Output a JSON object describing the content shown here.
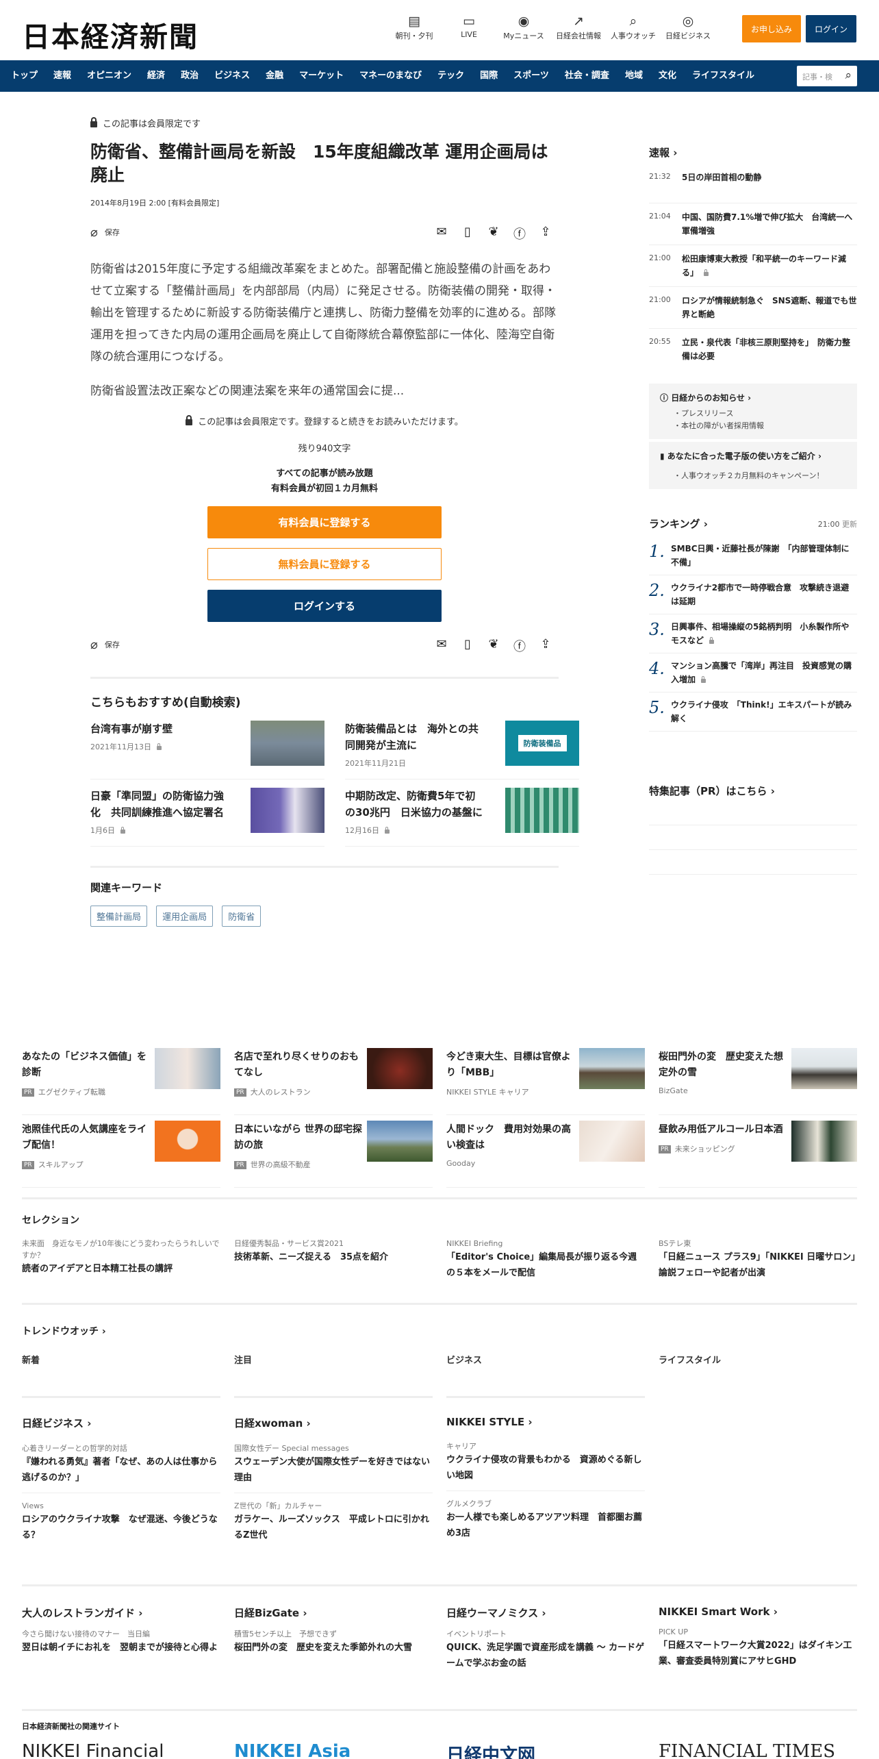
{
  "header": {
    "logo": "日本経済新聞",
    "icons": [
      {
        "label": "朝刊・夕刊",
        "icon": "newspaper-icon",
        "glyph": "▤"
      },
      {
        "label": "LIVE",
        "icon": "video-icon",
        "glyph": "▭"
      },
      {
        "label": "Myニュース",
        "icon": "user-icon",
        "glyph": "◉"
      },
      {
        "label": "日経会社情報",
        "icon": "chart-icon",
        "glyph": "↗"
      },
      {
        "label": "人事ウオッチ",
        "icon": "search-person-icon",
        "glyph": "⌕"
      },
      {
        "label": "日経ビジネス",
        "icon": "compass-icon",
        "glyph": "◎"
      }
    ],
    "apply_label": "お申し込み",
    "login_label": "ログイン"
  },
  "nav": {
    "items": [
      "トップ",
      "速報",
      "オピニオン",
      "経済",
      "政治",
      "ビジネス",
      "金融",
      "マーケット",
      "マネーのまなび",
      "テック",
      "国際",
      "スポーツ",
      "社会・調査",
      "地域",
      "文化",
      "ライフスタイル"
    ],
    "search_placeholder": "記事・検"
  },
  "article": {
    "member_only": "この記事は会員限定です",
    "title": "防衛省、整備計画局を新設　15年度組織改革 運用企画局は廃止",
    "date": "2014年8月19日 2:00 [有料会員限定]",
    "save_label": "保存",
    "body": [
      "防衛省は2015年度に予定する組織改革案をまとめた。部署配備と施設整備の計画をあわせて立案する「整備計画局」を内部部局（内局）に発足させる。防衛装備の開発・取得・輸出を管理するために新設する防衛装備庁と連携し、防衛力整備を効率的に進める。部隊運用を担ってきた内局の運用企画局を廃止して自衛隊統合幕僚監部に一体化、陸海空自衛隊の統合運用につなげる。",
      "防衛省設置法改正案などの関連法案を来年の通常国会に提..."
    ],
    "paywall_note": "この記事は会員限定です。登録すると続きをお読みいただけます。",
    "remaining": "残り940文字",
    "perk1": "すべての記事が読み放題",
    "perk2": "有料会員が初回１カ月無料",
    "btn_paid": "有料会員に登録する",
    "btn_free": "無料会員に登録する",
    "btn_login": "ログインする"
  },
  "recommend": {
    "heading": "こちらもおすすめ(自動検索)",
    "items": [
      {
        "title": "台湾有事が崩す壁",
        "date": "2021年11月13日"
      },
      {
        "title": "防衛装備品とは　海外との共同開発が主流に",
        "date": "2021年11月21日",
        "thumb_text": "防衛装備品"
      },
      {
        "title": "日豪「準同盟」の防衛協力強化　共同訓練推進へ協定署名",
        "date": "1月6日"
      },
      {
        "title": "中期防改定、防衛費5年で初の30兆円　日米協力の基盤に",
        "date": "12月16日"
      }
    ]
  },
  "keywords": {
    "heading": "関連キーワード",
    "items": [
      "整備計画局",
      "運用企画局",
      "防衛省"
    ]
  },
  "sidebar": {
    "flash_heading": "速報",
    "flash": [
      {
        "time": "21:32",
        "text": "5日の岸田首相の動静"
      },
      {
        "time": "21:04",
        "text": "中国、国防費7.1%増で伸び拡大　台湾統一へ軍備増強"
      },
      {
        "time": "21:00",
        "text": "松田康博東大教授「和平統一のキーワード減る」"
      },
      {
        "time": "21:00",
        "text": "ロシアが情報統制急ぐ　SNS遮断、報道でも世界と断絶"
      },
      {
        "time": "20:55",
        "text": "立民・泉代表「非核三原則堅持を」　防衛力整備は必要"
      }
    ],
    "notice_heading": "日経からのお知らせ",
    "notices": [
      "プレスリリース",
      "本社の障がい者採用情報"
    ],
    "ebook_heading": "あなたに合った電子版の使い方をご紹介",
    "ebook_items": [
      "人事ウオッチ２カ月無料のキャンペーン！"
    ],
    "ranking_heading": "ランキング",
    "ranking_time": "21:00",
    "ranking_update": "更新",
    "ranking": [
      {
        "n": "1.",
        "text": "SMBC日興・近藤社長が陳謝　「内部管理体制に不備」"
      },
      {
        "n": "2.",
        "text": "ウクライナ2都市で一時停戦合意　攻撃続き退避は延期"
      },
      {
        "n": "3.",
        "text": "日興事件、相場操縦の5銘柄判明　小糸製作所やモスなど"
      },
      {
        "n": "4.",
        "text": "マンション高騰で「湾岸」再注目　投資感覚の購入増加"
      },
      {
        "n": "5.",
        "text": "ウクライナ侵攻　「Think!」エキスパートが読み解く"
      }
    ],
    "pr_heading": "特集記事（PR）はこちら"
  },
  "ads": [
    {
      "title": "あなたの「ビジネス価値」を診断",
      "src": "エグゼクティブ転職",
      "pr": true
    },
    {
      "title": "名店で至れり尽くせりのおもてなし",
      "src": "大人のレストラン",
      "pr": true
    },
    {
      "title": "今どき東大生、目標は官僚より「MBB」",
      "src": "NIKKEI STYLE キャリア",
      "pr": false
    },
    {
      "title": "桜田門外の変　歴史変えた想定外の雪",
      "src": "BizGate",
      "pr": false
    },
    {
      "title": "池照佳代氏の人気講座をライブ配信！",
      "src": "スキルアップ",
      "pr": true
    },
    {
      "title": "日本にいながら 世界の邸宅探訪の旅",
      "src": "世界の高級不動産",
      "pr": true
    },
    {
      "title": "人間ドック　費用対効果の高い検査は",
      "src": "Gooday",
      "pr": false
    },
    {
      "title": "昼飲み用低アルコール日本酒",
      "src": "未来ショッピング",
      "pr": true
    }
  ],
  "pr_label": "PR",
  "selection": {
    "heading": "セレクション",
    "items": [
      {
        "small": "未来面　身近なモノが10年後にどう変わったらうれしいですか？",
        "title": "読者のアイデアと日本精工社長の講評"
      },
      {
        "small": "日経優秀製品・サービス賞2021",
        "title": "技術革新、ニーズ捉える　35点を紹介"
      },
      {
        "small": "NIKKEI Briefing",
        "title": "「Editor's Choice」編集局長が振り返る今週の５本をメールで配信"
      },
      {
        "small": "BSテレ東",
        "title": "「日経ニュース プラス9」「NIKKEI 日曜サロン」論説フェローや記者が出演"
      }
    ]
  },
  "trend": {
    "heading": "トレンドウオッチ",
    "tabs": [
      "新着",
      "注目",
      "ビジネス",
      "ライフスタイル"
    ],
    "columns": [
      {
        "brand": "日経ビジネス",
        "entries": [
          {
            "small": "心着きリーダーとの哲学的対話",
            "title": "『嫌われる勇気』著者「なぜ、あの人は仕事から逃げるのか？」"
          },
          {
            "small": "Views",
            "title": "ロシアのウクライナ攻撃　なぜ混迷、今後どうなる？"
          }
        ]
      },
      {
        "brand": "日経xwoman",
        "entries": [
          {
            "small": "国際女性デー Special messages",
            "title": "スウェーデン大使が国際女性デーを好きではない理由"
          },
          {
            "small": "Z世代の「新」カルチャー",
            "title": "ガラケー、ルーズソックス　平成レトロに引かれるZ世代"
          }
        ]
      },
      {
        "brand": "NIKKEI STYLE",
        "entries": [
          {
            "small": "キャリア",
            "title": "ウクライナ侵攻の背景もわかる　資源めぐる新しい地図"
          },
          {
            "small": "グルメクラブ",
            "title": "お一人様でも楽しめるアツアツ料理　首都圏お薦め3店"
          }
        ]
      }
    ]
  },
  "more_links": [
    {
      "brand": "大人のレストランガイド",
      "small": "今さら聞けない接待のマナー　当日編",
      "title": "翌日は朝イチにお礼を　翌朝までが接待と心得よ"
    },
    {
      "brand": "日経BizGate",
      "small": "積雪5センチ以上　予想できず",
      "title": "桜田門外の変　歴史を変えた季節外れの大雪"
    },
    {
      "brand": "日経ウーマノミクス",
      "small": "イベントリポート",
      "title": "QUICK、洗足学園で資産形成を講義 ～ カードゲームで学ぶお金の話"
    },
    {
      "brand": "NIKKEI Smart Work",
      "small": "PICK UP",
      "title": "「日経スマートワーク大賞2022」はダイキン工業、審査委員特別賞にアサヒGHD"
    }
  ],
  "related_sites": {
    "heading": "日本経済新聞社の関連サイト",
    "logos": [
      "NIKKEI Financial",
      "NIKKEI Asia",
      "日経中文网",
      "FINANCIAL TIMES"
    ]
  }
}
